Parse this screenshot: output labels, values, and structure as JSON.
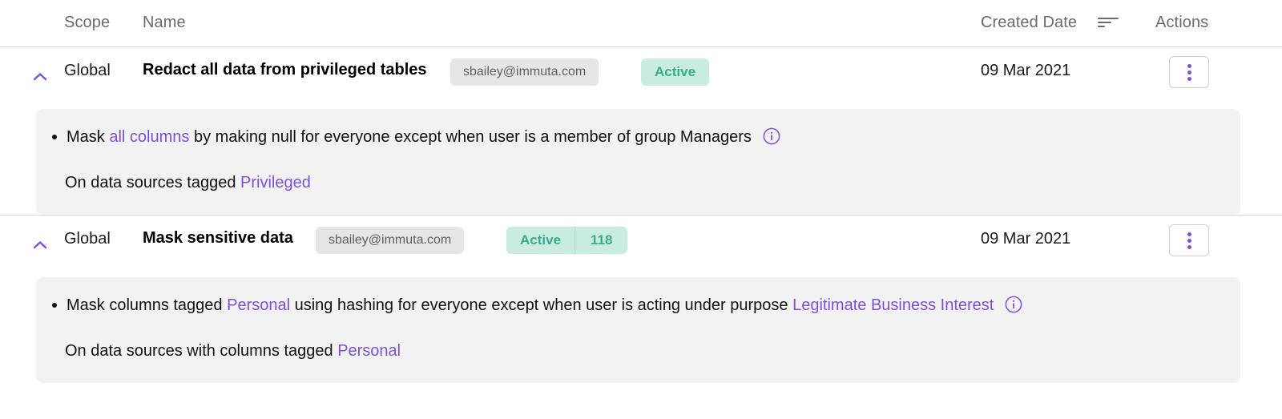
{
  "header": {
    "columns": {
      "scope": "Scope",
      "name": "Name",
      "created_date": "Created Date",
      "actions": "Actions"
    },
    "sort_icon": "sort-descending-icon"
  },
  "colors": {
    "accent_purple": "#7b52d6",
    "status_bg": "#c8ece0",
    "status_text": "#3aab8c",
    "owner_badge_bg": "#e6e6e6",
    "panel_bg": "#f2f2f2",
    "divider": "#d8d8d8"
  },
  "rows": [
    {
      "collapse_icon": "chevron-up-icon",
      "scope": "Global",
      "name": "Redact all data from privileged tables",
      "owner": "sbailey@immuta.com",
      "status": "Active",
      "count": null,
      "created_date": "09 Mar 2021",
      "actions_icon": "kebab-menu-icon",
      "rule": {
        "part1": "Mask ",
        "link1": "all columns",
        "part2": " by making null for everyone except when user is a member of group Managers",
        "info_icon": "info-circle-icon"
      },
      "scope_line": {
        "prefix": "On data sources tagged ",
        "link": "Privileged"
      }
    },
    {
      "collapse_icon": "chevron-up-icon",
      "scope": "Global",
      "name": "Mask sensitive data",
      "owner": "sbailey@immuta.com",
      "status": "Active",
      "count": "118",
      "created_date": "09 Mar 2021",
      "actions_icon": "kebab-menu-icon",
      "rule": {
        "part1": "Mask columns tagged ",
        "link1": "Personal",
        "part2": " using hashing for everyone except when user is acting under purpose ",
        "link2": "Legitimate Business Interest",
        "info_icon": "info-circle-icon"
      },
      "scope_line": {
        "prefix": "On data sources with columns tagged ",
        "link": "Personal"
      }
    }
  ]
}
